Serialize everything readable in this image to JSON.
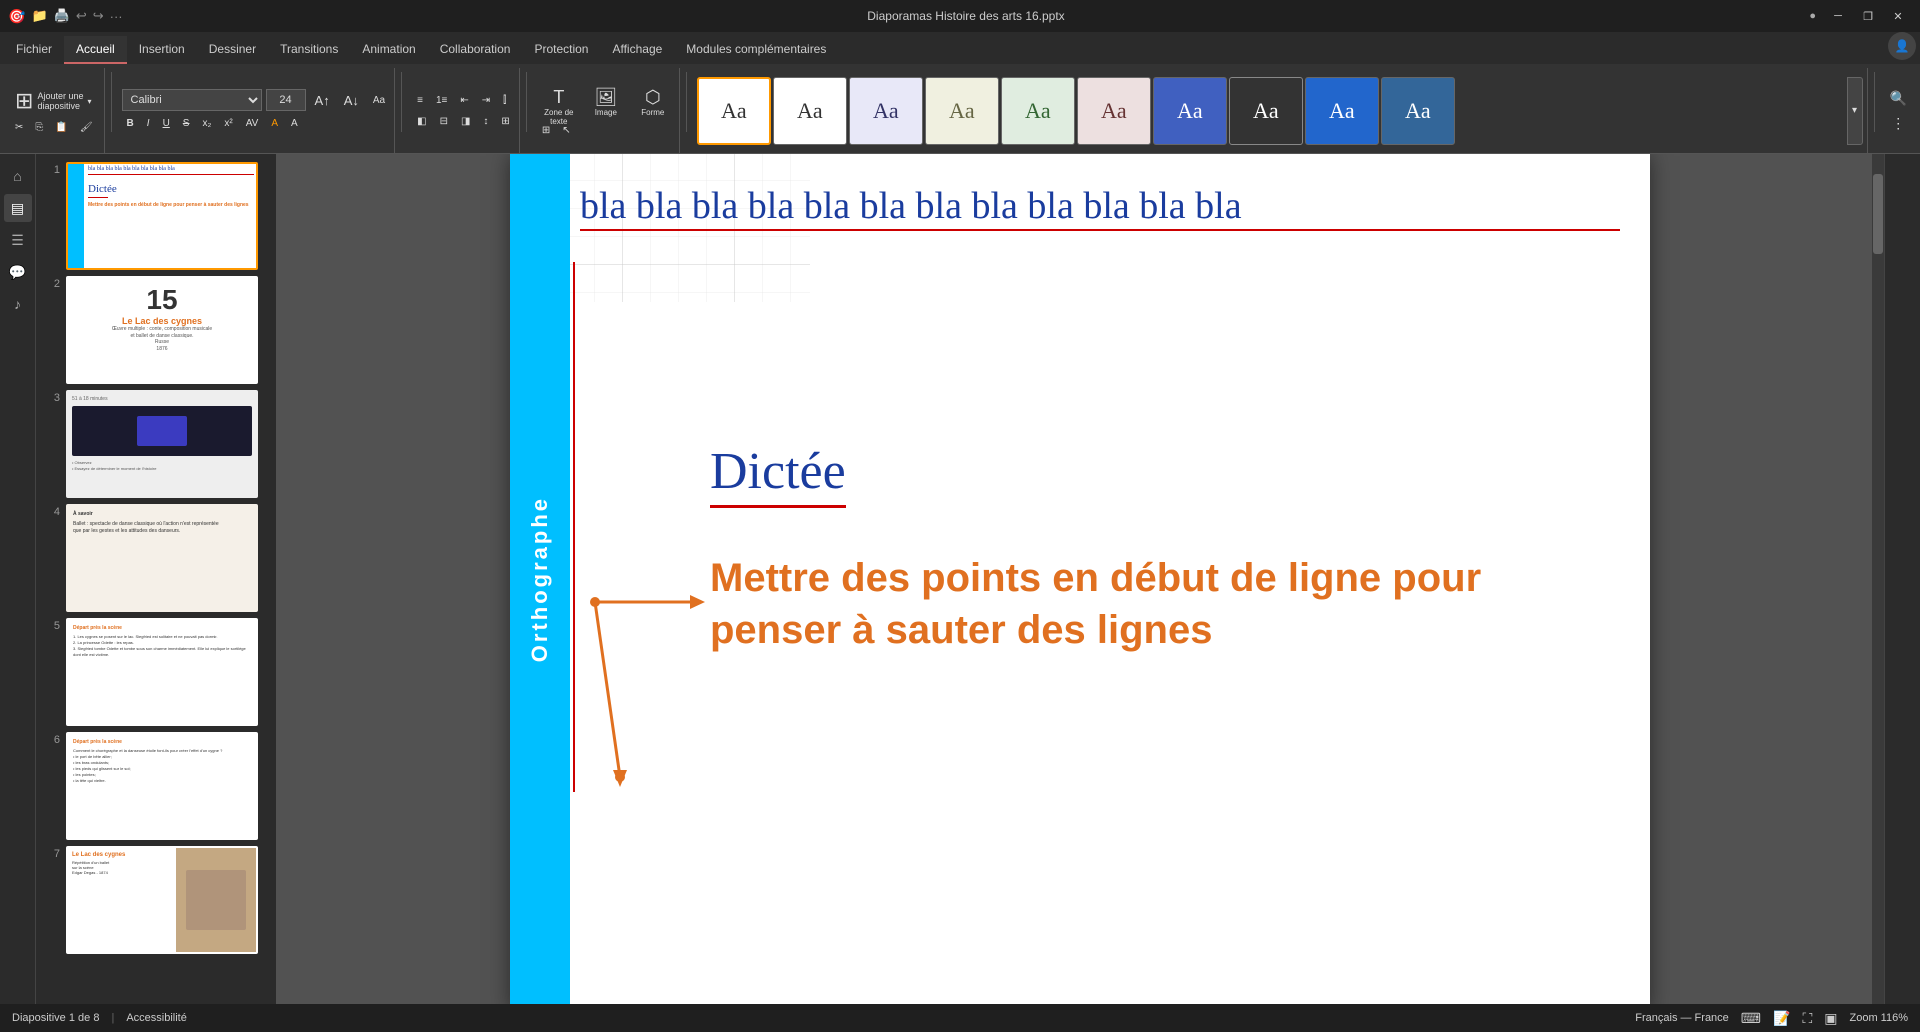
{
  "titlebar": {
    "title": "Diaporamas Histoire des arts 16.pptx",
    "win_controls": [
      "minimize",
      "restore",
      "close"
    ]
  },
  "ribbon": {
    "tabs": [
      {
        "id": "fichier",
        "label": "Fichier",
        "active": false
      },
      {
        "id": "accueil",
        "label": "Accueil",
        "active": true
      },
      {
        "id": "insertion",
        "label": "Insertion",
        "active": false
      },
      {
        "id": "dessiner",
        "label": "Dessiner",
        "active": false
      },
      {
        "id": "transitions",
        "label": "Transitions",
        "active": false
      },
      {
        "id": "animation",
        "label": "Animation",
        "active": false
      },
      {
        "id": "collaboration",
        "label": "Collaboration",
        "active": false
      },
      {
        "id": "protection",
        "label": "Protection",
        "active": false
      },
      {
        "id": "affichage",
        "label": "Affichage",
        "active": false
      },
      {
        "id": "modules",
        "label": "Modules complémentaires",
        "active": false
      }
    ],
    "add_slide_label": "Ajouter une\ndiapositive",
    "font_name": "Calibri",
    "font_size": "24"
  },
  "slides": [
    {
      "number": "1",
      "active": true,
      "bla_text": "bla bla bla bla bla bla bla bla bla bla bla bla",
      "dictee_label": "Dictée",
      "instruction": "Mettre des points en début de ligne pour penser à sauter des lignes",
      "blue_bar_text": "Orthographe"
    },
    {
      "number": "2",
      "title_number": "15",
      "title": "Le Lac des cygnes",
      "subtitle": "Œuvre multiple : conte, composition musicale\net ballet de danse classique.\nRusse\n1876"
    },
    {
      "number": "3",
      "duration": "51 à 18 minutes"
    },
    {
      "number": "4",
      "label": "À savoir"
    },
    {
      "number": "5",
      "label": "Départ près la scène"
    },
    {
      "number": "6",
      "label": "Départ près la scène"
    },
    {
      "number": "7",
      "label": "Le Lac des cygnes"
    }
  ],
  "canvas": {
    "bla_line": "bla bla bla bla bla bla bla bla bla bla bla bla",
    "dictee": "Dictée",
    "instruction_line1": "Mettre des points en début de ligne pour",
    "instruction_line2": "penser à sauter des lignes",
    "blue_bar_text": "Orthographe"
  },
  "bottom_bar": {
    "slide_info": "Diapositive 1 de 8",
    "language": "Français — France",
    "zoom_label": "Zoom 116%",
    "accessibility": "Accessibilité"
  },
  "left_nav_icons": [
    {
      "name": "home-icon",
      "glyph": "⌂"
    },
    {
      "name": "slides-icon",
      "glyph": "▤"
    },
    {
      "name": "outline-icon",
      "glyph": "☰"
    },
    {
      "name": "comments-icon",
      "glyph": "💬"
    },
    {
      "name": "notes-icon",
      "glyph": "♪"
    }
  ]
}
